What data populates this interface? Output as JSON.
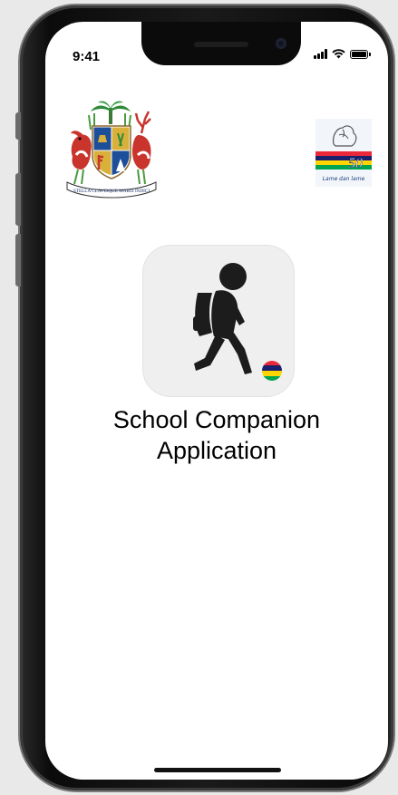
{
  "status_bar": {
    "time": "9:41",
    "icons": [
      "signal-icon",
      "wifi-icon",
      "battery-icon"
    ]
  },
  "logos": {
    "coat_of_arms_motto": "STELLA CLAVISQUE MARIS INDICI",
    "anniversary_number": "50",
    "anniversary_tagline": "Lame dan lame"
  },
  "app": {
    "icon": "student-walking-icon",
    "badge_icon": "mauritius-flag-icon",
    "title_line1": "School Companion",
    "title_line2": "Application"
  },
  "colors": {
    "mauritius_flag": [
      "#ea2839",
      "#1a206d",
      "#ffd500",
      "#00a551"
    ],
    "icon_background": "#efefef",
    "figure": "#1c1c1c"
  }
}
